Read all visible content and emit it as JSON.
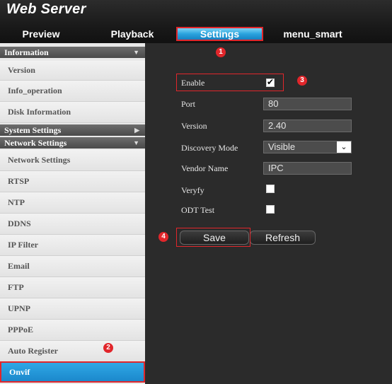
{
  "app": {
    "title": "Web Server"
  },
  "nav": {
    "tabs": [
      {
        "label": "Preview"
      },
      {
        "label": "Playback"
      },
      {
        "label": "Settings",
        "active": true
      },
      {
        "label": "menu_smart"
      }
    ]
  },
  "sidebar": {
    "groups": [
      {
        "label": "Information",
        "arrow": "▼"
      },
      {
        "label": "System Settings",
        "arrow": "▶"
      },
      {
        "label": "Network Settings",
        "arrow": "▼"
      }
    ],
    "information_items": [
      {
        "label": "Version"
      },
      {
        "label": "Info_operation"
      },
      {
        "label": "Disk Information"
      }
    ],
    "network_items": [
      {
        "label": "Network Settings"
      },
      {
        "label": "RTSP"
      },
      {
        "label": "NTP"
      },
      {
        "label": "DDNS"
      },
      {
        "label": "IP Filter"
      },
      {
        "label": "Email"
      },
      {
        "label": "FTP"
      },
      {
        "label": "UPNP"
      },
      {
        "label": "PPPoE"
      },
      {
        "label": "Auto Register"
      },
      {
        "label": "Onvif",
        "active": true
      }
    ]
  },
  "form": {
    "enable": {
      "label": "Enable",
      "checked": true,
      "check_glyph": "✔"
    },
    "port": {
      "label": "Port",
      "value": "80"
    },
    "version": {
      "label": "Version",
      "value": "2.40"
    },
    "discovery_mode": {
      "label": "Discovery Mode",
      "value": "Visible",
      "arrow": "⌄"
    },
    "vendor_name": {
      "label": "Vendor Name",
      "value": "IPC"
    },
    "verify": {
      "label": "Veryfy",
      "checked": false
    },
    "odt_test": {
      "label": "ODT Test",
      "checked": false
    },
    "save_label": "Save",
    "refresh_label": "Refresh"
  },
  "callouts": [
    "1",
    "2",
    "3",
    "4"
  ],
  "colors": {
    "accent": "#1b88cc",
    "highlight": "#e1262b",
    "panel": "#2b2b2b"
  }
}
